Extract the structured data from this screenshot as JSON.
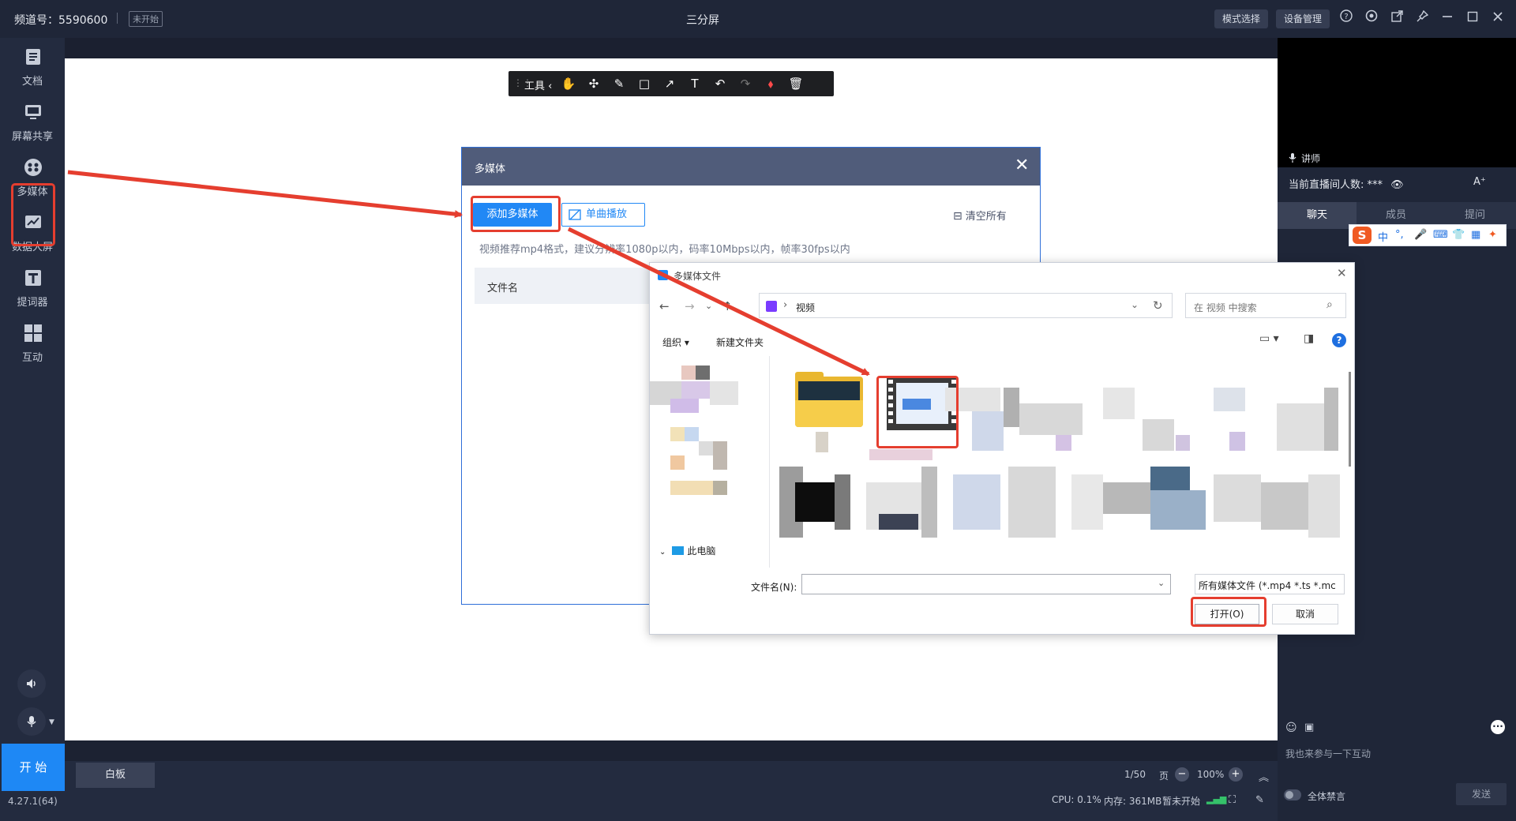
{
  "topbar": {
    "channel": "频道号：5590600",
    "status": "未开始",
    "title": "三分屏",
    "mode_btn": "模式选择",
    "device_btn": "设备管理",
    "icons": [
      "help-icon",
      "settings-icon",
      "share-icon",
      "pin-icon",
      "minimize-icon",
      "maximize-icon",
      "close-icon"
    ]
  },
  "sidebar": {
    "items": [
      {
        "label": "文档",
        "icon": "document-icon"
      },
      {
        "label": "屏幕共享",
        "icon": "screen-share-icon"
      },
      {
        "label": "多媒体",
        "icon": "multimedia-icon"
      },
      {
        "label": "数据大屏",
        "icon": "data-screen-icon"
      },
      {
        "label": "提词器",
        "icon": "teleprompter-icon"
      },
      {
        "label": "互动",
        "icon": "interaction-icon"
      }
    ],
    "start": "开 始",
    "version": "4.27.1(64)"
  },
  "toolbar": {
    "label": "工具 ‹",
    "icons": [
      "hand-icon",
      "pointer-icon",
      "pen-icon",
      "rectangle-icon",
      "arrow-icon",
      "text-icon",
      "undo-icon",
      "redo-icon",
      "eraser-icon",
      "trash-icon"
    ]
  },
  "bottom": {
    "whiteboard": "白板",
    "page": "1/50",
    "page_unit": "页",
    "zoom": "100%",
    "cpu": "CPU: 0.1%",
    "memory": "内存: 361MB",
    "record": "暂未开始"
  },
  "rightpanel": {
    "teacher": "讲师",
    "viewers": "当前直播间人数: ***",
    "font_icon": "A⁺",
    "tabs": [
      "聊天",
      "成员",
      "提问"
    ],
    "active_tab": "聊天",
    "ime": {
      "s": "S",
      "lang": "中",
      "punct": "°,"
    },
    "chat_placeholder": "我也来参与一下互动",
    "mute_all": "全体禁言",
    "send": "发送"
  },
  "mm_dialog": {
    "title": "多媒体",
    "add": "添加多媒体",
    "single": "单曲播放",
    "clear": "清空所有",
    "hint": "视频推荐mp4格式，建议分辨率1080p以内，码率10Mbps以内，帧率30fps以内",
    "col_filename": "文件名"
  },
  "file_dialog": {
    "title": "多媒体文件",
    "path": "视频",
    "search_placeholder": "在 视频 中搜索",
    "organize": "组织 ▾",
    "new_folder": "新建文件夹",
    "this_pc": "此电脑",
    "filename_label": "文件名(N):",
    "filter": "所有媒体文件 (*.mp4 *.ts *.mc",
    "open": "打开(O)",
    "cancel": "取消"
  },
  "colors": {
    "accent": "#2188f5",
    "highlight": "#e53e2f",
    "dark_bg": "#1f2638"
  }
}
